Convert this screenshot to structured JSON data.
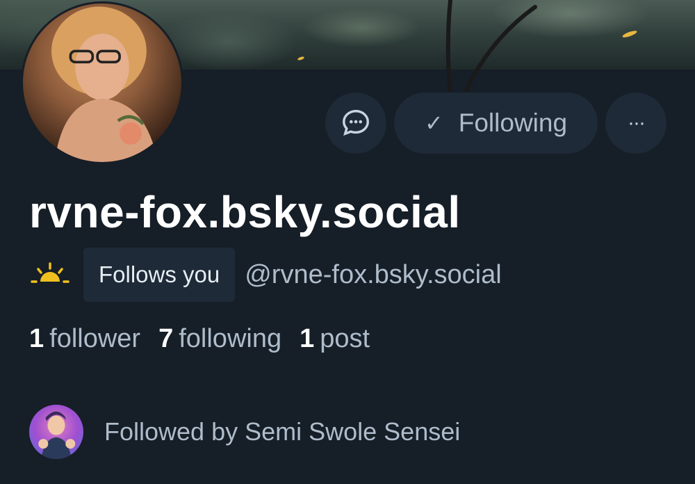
{
  "profile": {
    "display_name": "rvne-fox.bsky.social",
    "handle": "@rvne-fox.bsky.social",
    "follows_you_label": "Follows you",
    "status_icon": "sun-icon"
  },
  "actions": {
    "message_icon": "chat-bubble-icon",
    "follow_check": "✓",
    "follow_label": "Following",
    "more_label": "···"
  },
  "stats": {
    "followers_count": "1",
    "followers_label": "follower",
    "following_count": "7",
    "following_label": "following",
    "posts_count": "1",
    "posts_label": "post"
  },
  "followed_by": {
    "text": "Followed by Semi Swole Sensei"
  },
  "colors": {
    "background": "#161e27",
    "button_bg": "#1e2a37",
    "muted_text": "#aebccb",
    "sun": "#f0c020"
  }
}
